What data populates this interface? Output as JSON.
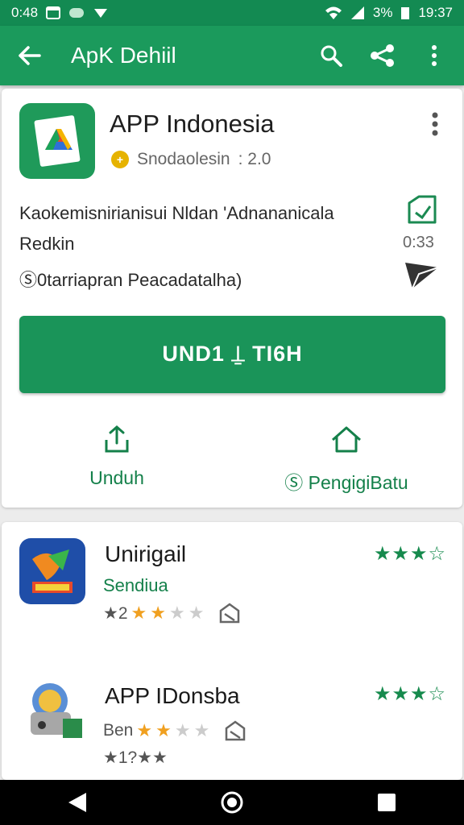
{
  "status_bar": {
    "time_left": "0:48",
    "battery": "3%",
    "time_right": "19:37"
  },
  "toolbar": {
    "title": "ApK Dehiil"
  },
  "app": {
    "name": "APP Indonesia",
    "developer": "Snodaolesin",
    "rating": ": 2.0",
    "description": "Kaokemisnirianisui Nldan 'Adnananicala Redkin",
    "note": "Ⓢ0tarriapran Peacadatalha)",
    "side_time": "0:33",
    "install_label": "UND1 ⍊ TI6H",
    "share_label": "Unduh",
    "home_label": "Ⓢ PengigiBatu"
  },
  "related": [
    {
      "title": "Unirigail",
      "subtitle": "Sendiua",
      "rating_prefix": "★2",
      "green_stars": "★★½"
    },
    {
      "title": "APP IDonsba",
      "subtitle": "Ben",
      "rating_prefix": "",
      "extra": "★1?★★",
      "green_stars": "★★½"
    }
  ],
  "colors": {
    "primary": "#1b9a5c",
    "status_bar": "#138a52",
    "accent_text": "#14804a"
  }
}
